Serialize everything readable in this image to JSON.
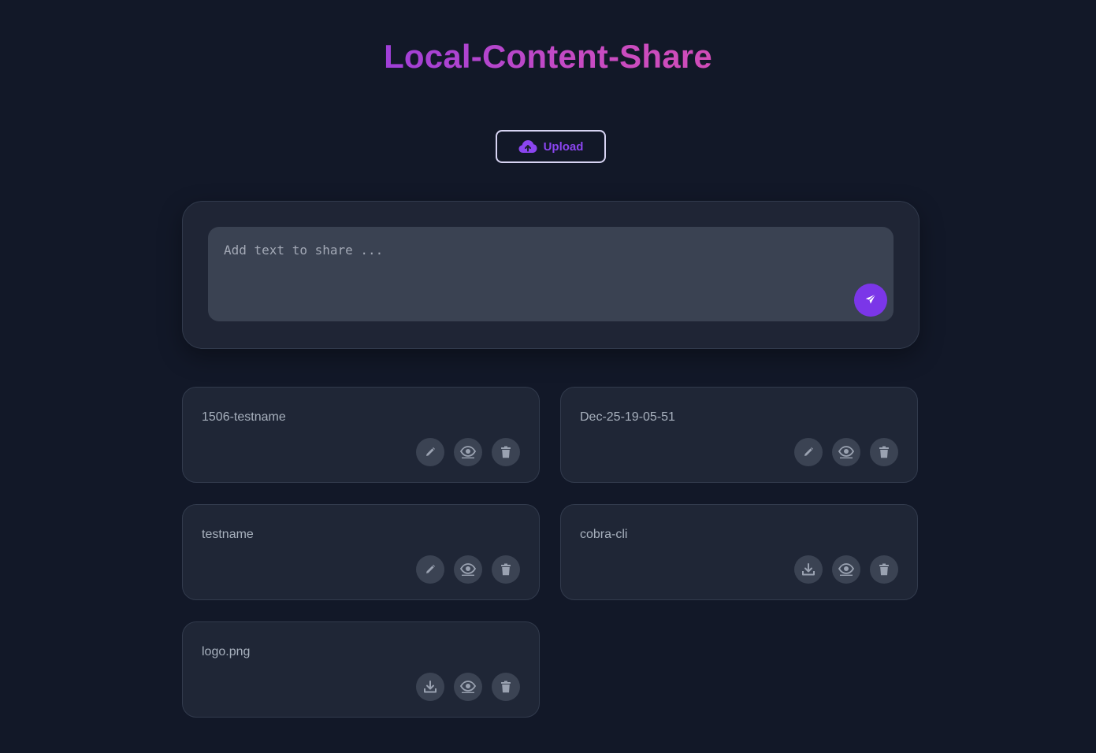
{
  "header": {
    "title": "Local-Content-Share"
  },
  "upload": {
    "label": "Upload",
    "icon": "cloud-upload-icon"
  },
  "composer": {
    "placeholder": "Add text to share ...",
    "value": "",
    "send_icon": "paper-plane-icon"
  },
  "items": [
    {
      "name": "1506-testname",
      "type": "text",
      "actions": [
        "edit",
        "view",
        "delete"
      ]
    },
    {
      "name": "Dec-25-19-05-51",
      "type": "text",
      "actions": [
        "edit",
        "view",
        "delete"
      ]
    },
    {
      "name": "testname",
      "type": "text",
      "actions": [
        "edit",
        "view",
        "delete"
      ]
    },
    {
      "name": "cobra-cli",
      "type": "file",
      "actions": [
        "download",
        "view",
        "delete"
      ]
    },
    {
      "name": "logo.png",
      "type": "file",
      "actions": [
        "download",
        "view",
        "delete"
      ]
    }
  ],
  "colors": {
    "background": "#121828",
    "accent": "#7b36e8",
    "title_gradient_start": "#9f3fd8",
    "title_gradient_end": "#d04cb8",
    "card": "#1f2636",
    "action_button": "#3b4353",
    "icon": "#9aa2b1"
  }
}
